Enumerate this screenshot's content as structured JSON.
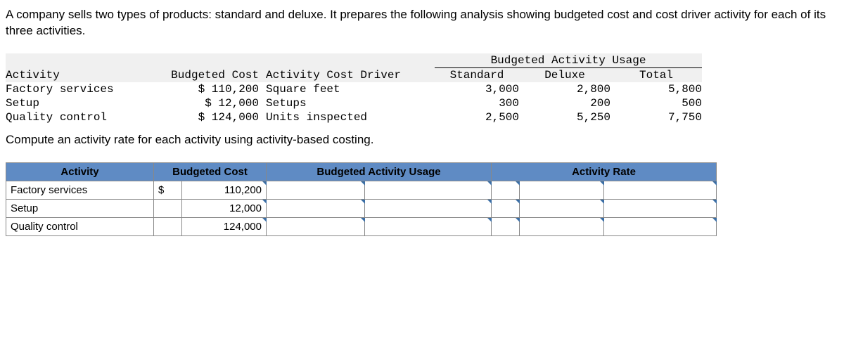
{
  "intro": "A company sells two types of products: standard and deluxe. It prepares the following analysis showing budgeted cost and cost driver activity for each of its three activities.",
  "dataTable": {
    "usageHeader": "Budgeted Activity Usage",
    "headers": {
      "activity": "Activity",
      "cost": "Budgeted Cost",
      "driver": "Activity Cost Driver",
      "standard": "Standard",
      "deluxe": "Deluxe",
      "total": "Total"
    },
    "rows": [
      {
        "activity": "Factory services",
        "cost": "$ 110,200",
        "driver": "Square feet",
        "standard": "3,000",
        "deluxe": "2,800",
        "total": "5,800"
      },
      {
        "activity": "Setup",
        "cost": "$ 12,000",
        "driver": "Setups",
        "standard": "300",
        "deluxe": "200",
        "total": "500"
      },
      {
        "activity": "Quality control",
        "cost": "$ 124,000",
        "driver": "Units inspected",
        "standard": "2,500",
        "deluxe": "5,250",
        "total": "7,750"
      }
    ]
  },
  "instruction": "Compute an activity rate for each activity using activity-based costing.",
  "answerTable": {
    "headers": {
      "activity": "Activity",
      "cost": "Budgeted Cost",
      "usage": "Budgeted Activity Usage",
      "rate": "Activity Rate"
    },
    "rows": [
      {
        "activity": "Factory services",
        "currency": "$",
        "cost": "110,200"
      },
      {
        "activity": "Setup",
        "currency": "",
        "cost": "12,000"
      },
      {
        "activity": "Quality control",
        "currency": "",
        "cost": "124,000"
      }
    ]
  }
}
